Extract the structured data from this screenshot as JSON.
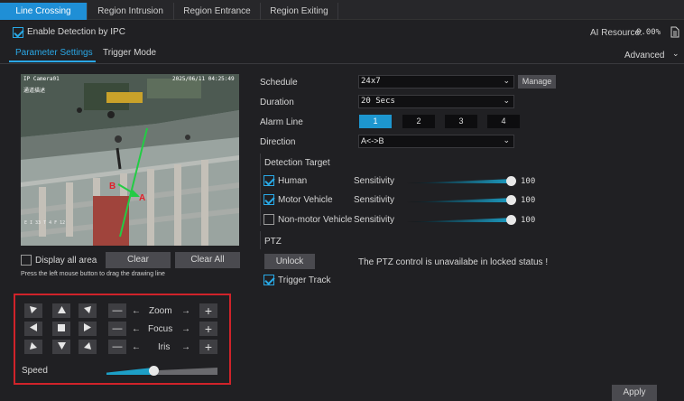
{
  "tabs": [
    {
      "label": "Line Crossing",
      "active": true
    },
    {
      "label": "Region Intrusion",
      "active": false
    },
    {
      "label": "Region Entrance",
      "active": false
    },
    {
      "label": "Region Exiting",
      "active": false
    }
  ],
  "enable_detection": {
    "label": "Enable Detection by IPC",
    "checked": true
  },
  "ai_resource": {
    "label": "AI Resource:",
    "value": "0.00%"
  },
  "subtabs": [
    {
      "label": "Parameter Settings",
      "active": true
    },
    {
      "label": "Trigger Mode",
      "active": false
    }
  ],
  "advanced_label": "Advanced",
  "video": {
    "camera_label": "IP Camera01",
    "osd_sub": "通道描述",
    "timestamp": "2025/06/11 04:25:49",
    "line_label_b": "B",
    "line_label_a": "A",
    "corner_text": "E I 33 T 4 F 12"
  },
  "display_all_area": {
    "label": "Display all area",
    "checked": false
  },
  "clear_label": "Clear",
  "clear_all_label": "Clear All",
  "hint": "Press the left mouse button to drag the drawing line",
  "schedule": {
    "label": "Schedule",
    "value": "24x7",
    "manage_label": "Manage"
  },
  "duration": {
    "label": "Duration",
    "value": "20 Secs"
  },
  "alarm_line": {
    "label": "Alarm Line",
    "options": [
      "1",
      "2",
      "3",
      "4"
    ],
    "selected": "1"
  },
  "direction": {
    "label": "Direction",
    "value": "A<->B"
  },
  "detection_target": {
    "title": "Detection Target",
    "sensitivity_label": "Sensitivity",
    "items": [
      {
        "label": "Human",
        "checked": true,
        "sensitivity": 100
      },
      {
        "label": "Motor Vehicle",
        "checked": true,
        "sensitivity": 100
      },
      {
        "label": "Non-motor Vehicle",
        "checked": false,
        "sensitivity": 100
      }
    ]
  },
  "ptz": {
    "title": "PTZ",
    "unlock_label": "Unlock",
    "status_text": "The PTZ control is unavailabe in locked status !",
    "trigger_track": {
      "label": "Trigger Track",
      "checked": true
    }
  },
  "ptz_panel": {
    "zoom_label": "Zoom",
    "focus_label": "Focus",
    "iris_label": "Iris",
    "speed_label": "Speed",
    "speed_value": 0.42,
    "minus_glyph": "—",
    "plus_glyph": "+",
    "left_arrow": "←",
    "right_arrow": "→"
  },
  "apply_label": "Apply",
  "colors": {
    "accent": "#1f8fd6",
    "slider": "#1d9fc6",
    "highlight_box": "#d0232a"
  }
}
